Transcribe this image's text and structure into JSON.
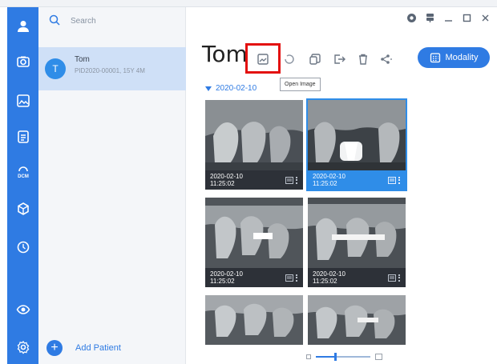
{
  "app": {
    "search": {
      "placeholder": "Search",
      "value": ""
    },
    "patient": {
      "name": "Tom",
      "avatar_letter": "T",
      "meta": "PID2020-00001, 15Y 4M"
    },
    "add_patient_label": "Add Patient",
    "title": "Tom",
    "tooltip": "Open Image",
    "modality_label": "Modality",
    "date_group": "2020-02-10",
    "zoom_level": 0.35,
    "accent_color": "#2f7be3",
    "highlight_color": "#e3100f"
  },
  "rail": {
    "items": [
      {
        "icon": "user-icon"
      },
      {
        "icon": "camera-icon"
      },
      {
        "icon": "image-icon"
      },
      {
        "icon": "document-icon"
      },
      {
        "icon": "dcm-icon"
      },
      {
        "icon": "cube-icon"
      },
      {
        "icon": "clock-icon"
      },
      {
        "icon": "eye-icon"
      },
      {
        "icon": "settings-icon"
      }
    ]
  },
  "toolbar": {
    "icons": [
      "open-image-icon",
      "rotate-icon",
      "copy-icon",
      "export-icon",
      "trash-icon",
      "share-icon"
    ]
  },
  "thumbnails": [
    {
      "date": "2020-02-10",
      "time": "11:25:02",
      "selected": false
    },
    {
      "date": "2020-02-10",
      "time": "11:25:02",
      "selected": true
    },
    {
      "date": "2020-02-10",
      "time": "11:25:02",
      "selected": false
    },
    {
      "date": "2020-02-10",
      "time": "11:25:02",
      "selected": false
    },
    {
      "date": "",
      "time": "",
      "selected": false
    },
    {
      "date": "",
      "time": "",
      "selected": false
    }
  ]
}
